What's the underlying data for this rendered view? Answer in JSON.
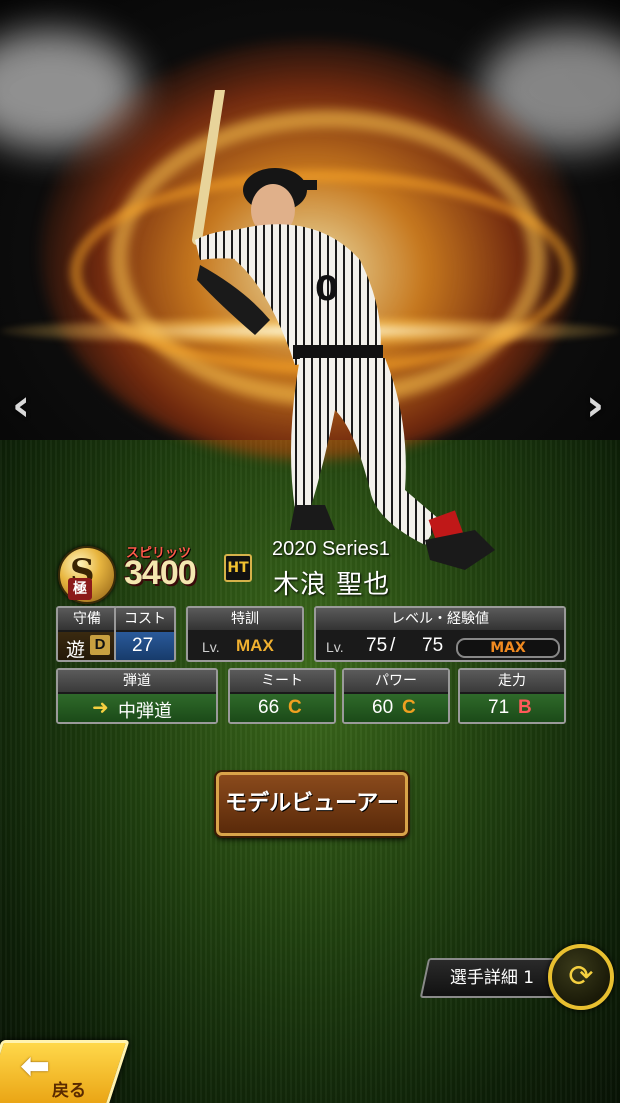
{
  "nav": {
    "prev_label": "‹",
    "next_label": "›"
  },
  "card": {
    "rank_letter": "S",
    "rank_sub": "極",
    "spirits_label": "スピリッツ",
    "spirits_value": "3400",
    "team_logo": "HT",
    "series": "2020 Series1",
    "player_name": "木浪 聖也"
  },
  "stats": {
    "position": {
      "header": "守備",
      "value": "遊",
      "grade": "D"
    },
    "cost": {
      "header": "コスト",
      "value": "27"
    },
    "training": {
      "header": "特訓",
      "lv_label": "Lv.",
      "value": "MAX"
    },
    "level": {
      "header": "レベル・経験値",
      "lv_label": "Lv.",
      "current": "75",
      "sep": "/",
      "max": "75",
      "exp_label": "MAX"
    },
    "trajectory": {
      "header": "弾道",
      "value": "中弾道"
    },
    "contact": {
      "header": "ミート",
      "value": "66",
      "grade": "C"
    },
    "power": {
      "header": "パワー",
      "value": "60",
      "grade": "C"
    },
    "speed": {
      "header": "走力",
      "value": "71",
      "grade": "B"
    }
  },
  "buttons": {
    "model_viewer": "モデルビューアー",
    "player_detail": "選手詳細 1",
    "back": "戻る"
  },
  "colors": {
    "gold": "#f0b030",
    "grade_c": "#f0a020",
    "grade_b": "#ff5a5a",
    "field_green": "#2f6a2a"
  }
}
